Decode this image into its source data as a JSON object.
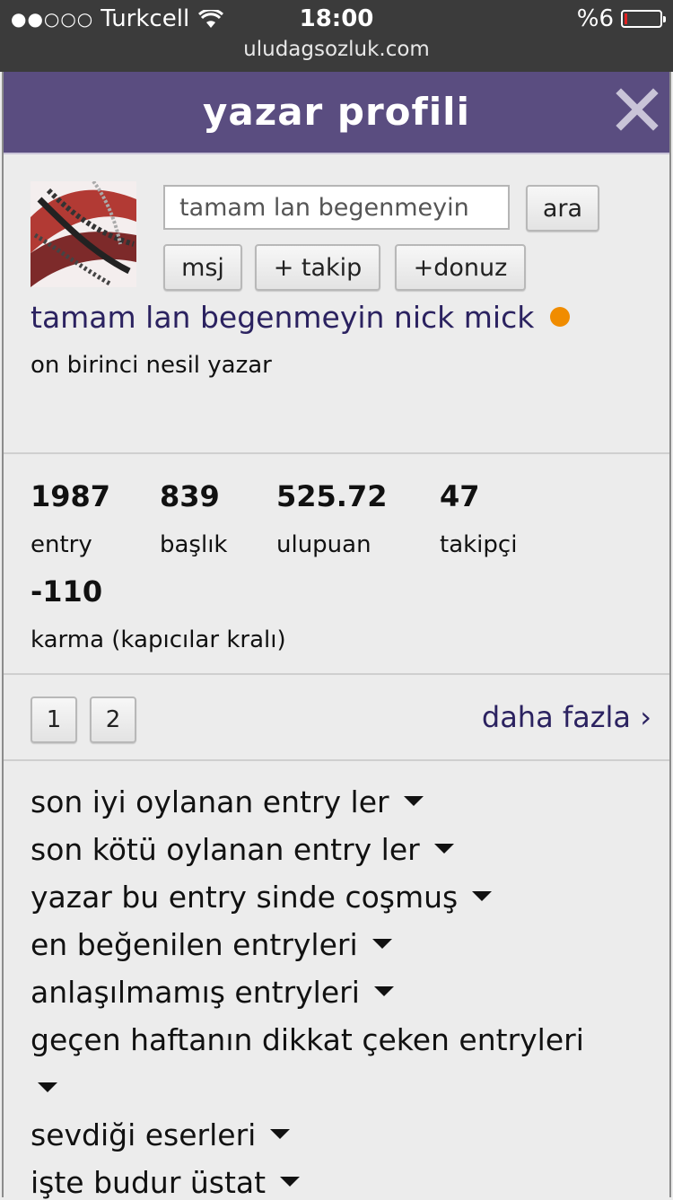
{
  "status_bar": {
    "carrier": "Turkcell",
    "signal_dots": "●●○○○",
    "time": "18:00",
    "battery": "%6",
    "url": "uludagsozluk.com"
  },
  "header": {
    "title": "yazar profili"
  },
  "search": {
    "value": "tamam lan begenmeyin",
    "button": "ara"
  },
  "actions": {
    "message": "msj",
    "follow": "+ takip",
    "pig": "+donuz"
  },
  "profile": {
    "username": "tamam lan begenmeyin nick mick",
    "rank": "on birinci nesil yazar",
    "online_color": "#f08c00"
  },
  "stats": [
    {
      "value": "1987",
      "label": "entry"
    },
    {
      "value": "839",
      "label": "başlık"
    },
    {
      "value": "525.72",
      "label": "ulupuan"
    },
    {
      "value": "47",
      "label": "takipçi"
    },
    {
      "value": "-110",
      "label": "karma (kapıcılar kralı)"
    }
  ],
  "pagination": {
    "pages": [
      "1",
      "2"
    ],
    "more": "daha fazla ›"
  },
  "menu": [
    "son iyi oylanan entry ler",
    "son kötü oylanan entry ler",
    "yazar bu entry sinde coşmuş",
    "en beğenilen entryleri",
    "anlaşılmamış entryleri",
    "geçen haftanın dikkat çeken entryleri",
    "sevdiği eserleri",
    "işte budur üstat"
  ],
  "colors": {
    "header_bg": "#5a4d80",
    "link": "#2b2260"
  }
}
